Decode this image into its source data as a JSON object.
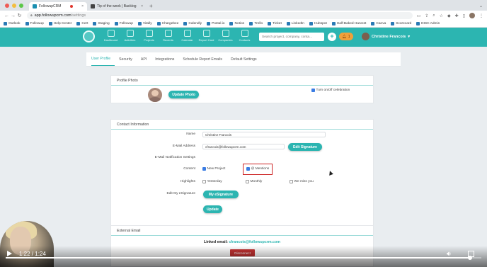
{
  "browser": {
    "tabs": [
      {
        "title": "FollowupCRM",
        "active": true,
        "recording": true
      },
      {
        "title": "Tip of the week | Backlog",
        "active": false
      }
    ],
    "new_tab": "+",
    "tab_menu": "⌄",
    "url_host": "app.followupcrm.com",
    "url_path": "/settings",
    "bookmarks": [
      "Outlook",
      "Followup",
      "Help Center",
      "Cert",
      "Staging",
      "Followup",
      "Vitally",
      "Chargebee",
      "Calendly",
      "Postal.io",
      "Notion",
      "Trello",
      "Ticket",
      "LinkedIn",
      "Hubspot",
      "Half-Baked Harvest",
      "Canva",
      "Scorecard",
      "DISC Admin"
    ]
  },
  "header": {
    "nav": [
      "Dashboard",
      "Activities",
      "Projects",
      "Recents",
      "Calendar",
      "Report Card",
      "Companies",
      "Contacts"
    ],
    "search_placeholder": "Search project, company, conta...",
    "add_label": "+",
    "notif_label": "1",
    "user_name": "Christine Francois",
    "color_primary": "#2cb5b1",
    "color_accent": "#f0a03a"
  },
  "settings_tabs": [
    {
      "label": "User Profile",
      "active": true
    },
    {
      "label": "Security",
      "active": false
    },
    {
      "label": "API",
      "active": false
    },
    {
      "label": "Integrations",
      "active": false
    },
    {
      "label": "Schedule Report Emails",
      "active": false
    },
    {
      "label": "Default Settings",
      "active": false
    }
  ],
  "profile_photo": {
    "title": "Profile Photo",
    "update_button": "Update Photo",
    "celebration_label": "Turn on/off celebration",
    "celebration_checked": true
  },
  "contact": {
    "title": "Contact Information",
    "name_label": "Name",
    "name_value": "Christine Francois",
    "email_label": "E-Mail Address",
    "email_value": "cfrancois@followupcrm.com",
    "edit_signature": "Edit Signature",
    "notif_settings_label": "E-Mail Notification Settings",
    "content_label": "Content",
    "content_options": [
      {
        "label": "New Project",
        "checked": true
      },
      {
        "label": "@ Mentions",
        "checked": true
      }
    ],
    "highlights_label": "Highlights",
    "highlight_options": [
      {
        "label": "Yesterday",
        "checked": false
      },
      {
        "label": "Monthly",
        "checked": false
      },
      {
        "label": "We miss you",
        "checked": false
      }
    ],
    "esignature_label": "Edit My eSignature",
    "esignature_button": "My eSignature",
    "update_button": "Update"
  },
  "external_email": {
    "title": "External Email",
    "linked_prefix": "Linked email:",
    "linked_email": "cfrancois@followupcrm.com",
    "disconnect": "Disconnect"
  },
  "video": {
    "time": "1:22 / 1:24",
    "progress": 0.976
  }
}
